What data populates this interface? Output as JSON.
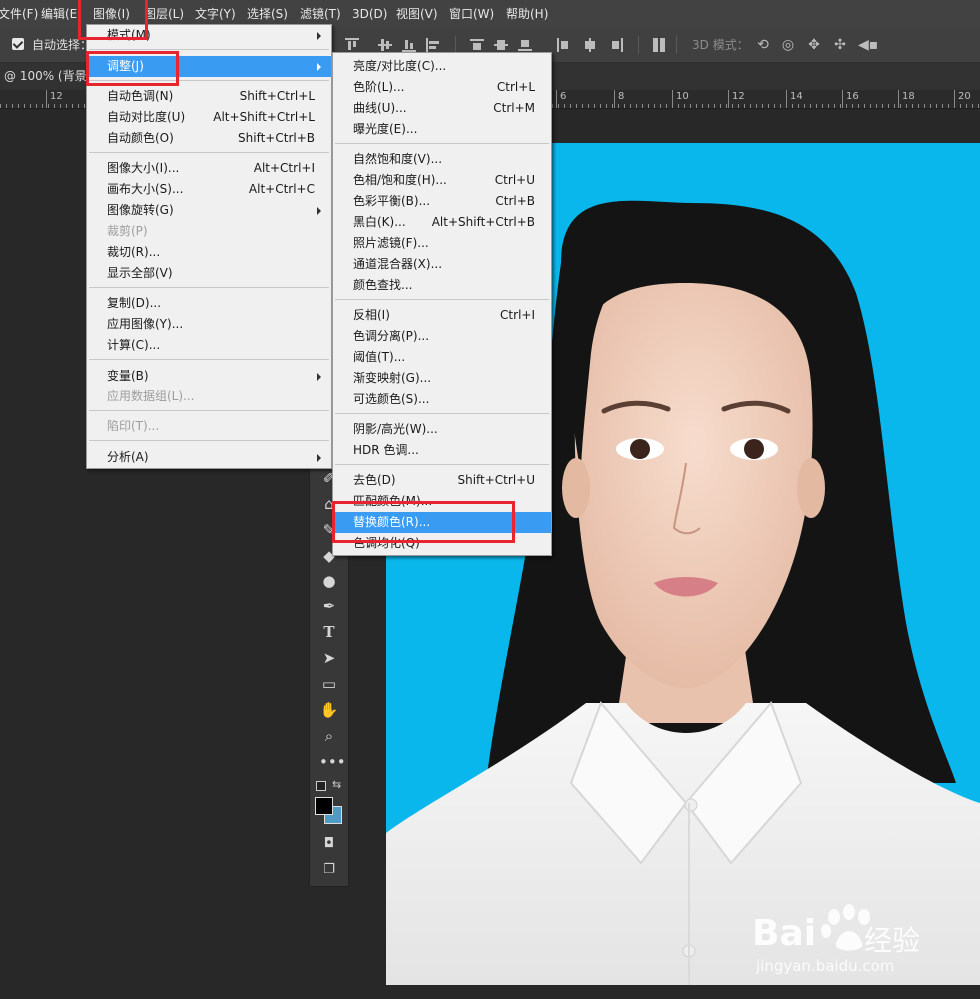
{
  "menubar": {
    "items": [
      "文件(F)",
      "编辑(E)",
      "图像(I)",
      "图层(L)",
      "文字(Y)",
      "选择(S)",
      "滤镜(T)",
      "3D(D)",
      "视图(V)",
      "窗口(W)",
      "帮助(H)"
    ]
  },
  "options": {
    "auto_select_label": "自动选择：",
    "mode_3d_label": "3D 模式："
  },
  "doc": {
    "tab_label": "@ 100% (背景"
  },
  "ruler": {
    "labels": [
      "12",
      "6",
      "8",
      "10",
      "12",
      "14",
      "16",
      "18",
      "20"
    ]
  },
  "image_menu": {
    "items": [
      {
        "label": "模式(M)",
        "shortcut": "",
        "submenu": true
      },
      {
        "label": "调整(J)",
        "shortcut": "",
        "submenu": true
      },
      {
        "label": "自动色调(N)",
        "shortcut": "Shift+Ctrl+L"
      },
      {
        "label": "自动对比度(U)",
        "shortcut": "Alt+Shift+Ctrl+L"
      },
      {
        "label": "自动颜色(O)",
        "shortcut": "Shift+Ctrl+B"
      },
      {
        "label": "图像大小(I)...",
        "shortcut": "Alt+Ctrl+I"
      },
      {
        "label": "画布大小(S)...",
        "shortcut": "Alt+Ctrl+C"
      },
      {
        "label": "图像旋转(G)",
        "shortcut": "",
        "submenu": true
      },
      {
        "label": "裁剪(P)",
        "shortcut": "",
        "disabled": true
      },
      {
        "label": "裁切(R)...",
        "shortcut": ""
      },
      {
        "label": "显示全部(V)",
        "shortcut": ""
      },
      {
        "label": "复制(D)...",
        "shortcut": ""
      },
      {
        "label": "应用图像(Y)...",
        "shortcut": ""
      },
      {
        "label": "计算(C)...",
        "shortcut": ""
      },
      {
        "label": "变量(B)",
        "shortcut": "",
        "submenu": true
      },
      {
        "label": "应用数据组(L)...",
        "shortcut": "",
        "disabled": true
      },
      {
        "label": "陷印(T)...",
        "shortcut": "",
        "disabled": true
      },
      {
        "label": "分析(A)",
        "shortcut": "",
        "submenu": true
      }
    ]
  },
  "adjust_menu": {
    "items": [
      {
        "label": "亮度/对比度(C)...",
        "shortcut": ""
      },
      {
        "label": "色阶(L)...",
        "shortcut": "Ctrl+L"
      },
      {
        "label": "曲线(U)...",
        "shortcut": "Ctrl+M"
      },
      {
        "label": "曝光度(E)...",
        "shortcut": ""
      },
      {
        "label": "自然饱和度(V)...",
        "shortcut": ""
      },
      {
        "label": "色相/饱和度(H)...",
        "shortcut": "Ctrl+U"
      },
      {
        "label": "色彩平衡(B)...",
        "shortcut": "Ctrl+B"
      },
      {
        "label": "黑白(K)...",
        "shortcut": "Alt+Shift+Ctrl+B"
      },
      {
        "label": "照片滤镜(F)...",
        "shortcut": ""
      },
      {
        "label": "通道混合器(X)...",
        "shortcut": ""
      },
      {
        "label": "颜色查找...",
        "shortcut": ""
      },
      {
        "label": "反相(I)",
        "shortcut": "Ctrl+I"
      },
      {
        "label": "色调分离(P)...",
        "shortcut": ""
      },
      {
        "label": "阈值(T)...",
        "shortcut": ""
      },
      {
        "label": "渐变映射(G)...",
        "shortcut": ""
      },
      {
        "label": "可选颜色(S)...",
        "shortcut": ""
      },
      {
        "label": "阴影/高光(W)...",
        "shortcut": ""
      },
      {
        "label": "HDR 色调...",
        "shortcut": ""
      },
      {
        "label": "去色(D)",
        "shortcut": "Shift+Ctrl+U"
      },
      {
        "label": "匹配颜色(M)...",
        "shortcut": ""
      },
      {
        "label": "替换颜色(R)...",
        "shortcut": ""
      },
      {
        "label": "色调均化(Q)",
        "shortcut": ""
      }
    ]
  },
  "watermark": {
    "brand": "Bai",
    "brand_cn": "经验",
    "url": "jingyan.baidu.com"
  },
  "colors": {
    "highlight": "#3a9bf2",
    "annotation": "#e8242f",
    "photo_bg": "#0ab7ec"
  }
}
